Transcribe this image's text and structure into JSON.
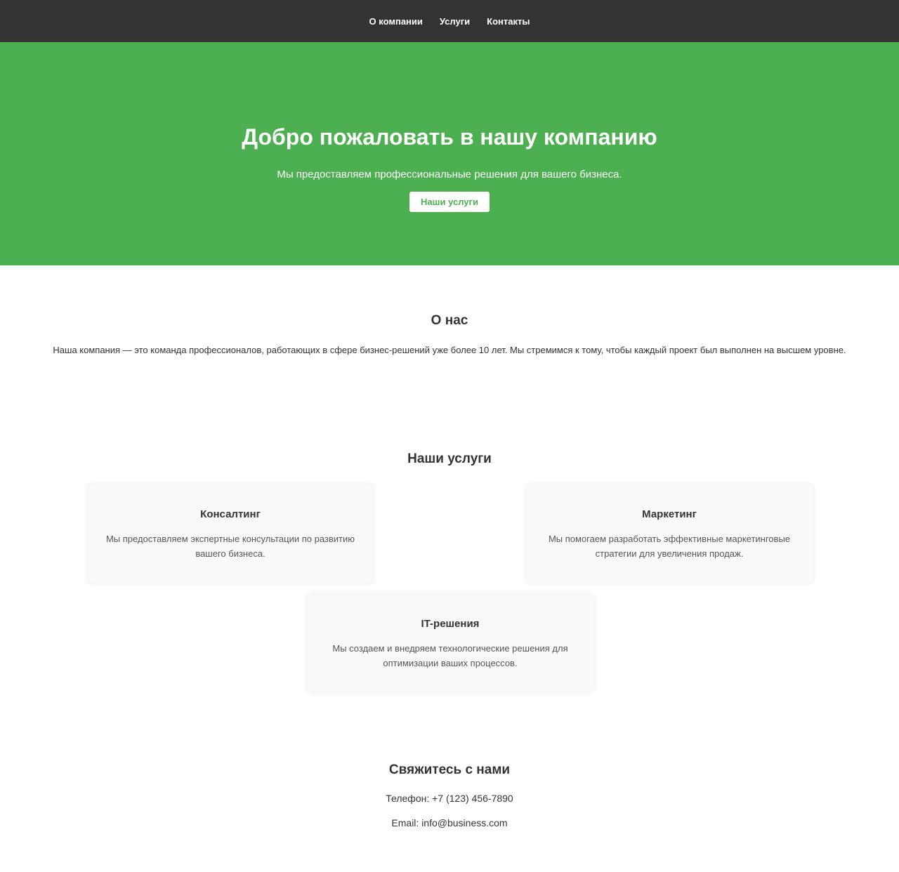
{
  "nav": {
    "items": [
      {
        "label": "О компании"
      },
      {
        "label": "Услуги"
      },
      {
        "label": "Контакты"
      }
    ]
  },
  "hero": {
    "title": "Добро пожаловать в нашу компанию",
    "subtitle": "Мы предоставляем профессиональные решения для вашего бизнеса.",
    "button_label": "Наши услуги"
  },
  "about": {
    "title": "О нас",
    "text": "Наша компания — это команда профессионалов, работающих в сфере бизнес-решений уже более 10 лет. Мы стремимся к тому, чтобы каждый проект был выполнен на высшем уровне."
  },
  "services": {
    "title": "Наши услуги",
    "cards": [
      {
        "title": "Консалтинг",
        "text": "Мы предоставляем экспертные консультации по развитию вашего бизнеса."
      },
      {
        "title": "Маркетинг",
        "text": "Мы помогаем разработать эффективные маркетинговые стратегии для увеличения продаж."
      },
      {
        "title": "IT-решения",
        "text": "Мы создаем и внедряем технологические решения для оптимизации ваших процессов."
      }
    ]
  },
  "contact": {
    "title": "Свяжитесь с нами",
    "phone": "Телефон: +7 (123) 456-7890",
    "email": "Email: info@business.com"
  },
  "colors": {
    "nav_bg": "#333333",
    "accent": "#4caf50",
    "card_bg": "#f9f9f9"
  }
}
